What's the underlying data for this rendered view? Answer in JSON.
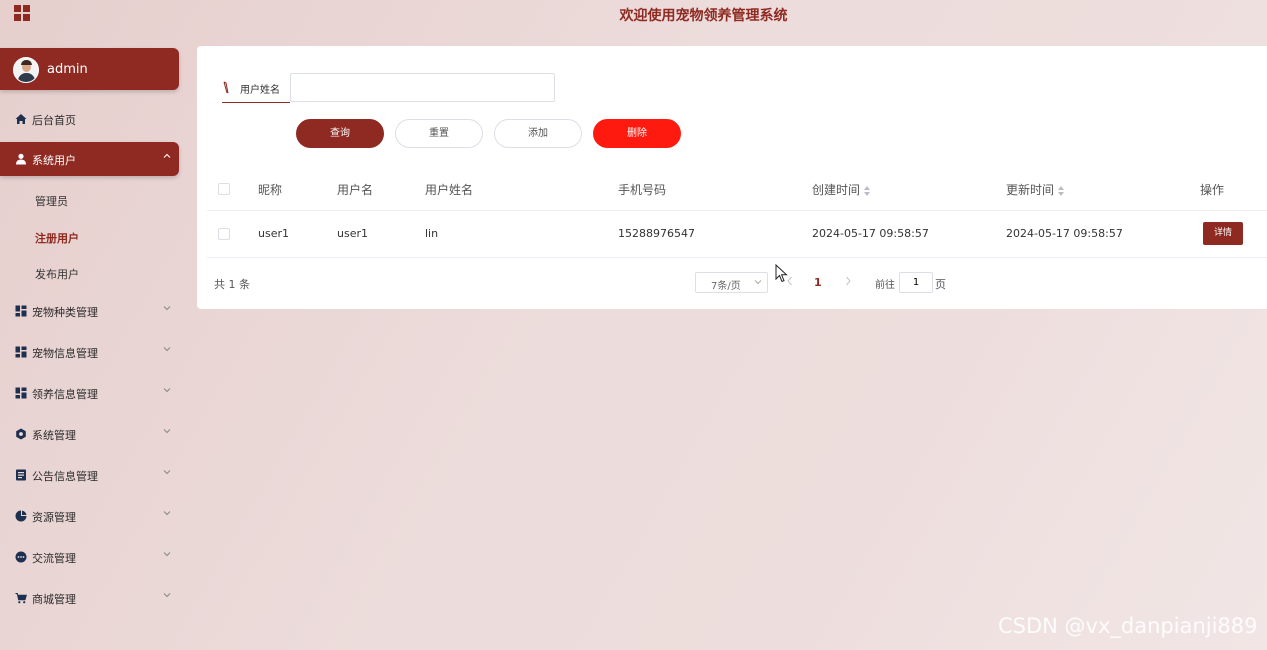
{
  "header": {
    "title": "欢迎使用宠物领养管理系统",
    "menu_icon": "grid-icon"
  },
  "user": {
    "name": "admin",
    "avatar": "avatar"
  },
  "sidebar": {
    "items": [
      {
        "label": "后台首页",
        "icon": "home-icon"
      },
      {
        "label": "系统用户",
        "icon": "user-icon",
        "expanded": true,
        "children": [
          {
            "label": "管理员"
          },
          {
            "label": "注册用户",
            "current": true
          },
          {
            "label": "发布用户"
          }
        ]
      },
      {
        "label": "宠物种类管理",
        "icon": "dashboard-icon"
      },
      {
        "label": "宠物信息管理",
        "icon": "dashboard-icon"
      },
      {
        "label": "领养信息管理",
        "icon": "dashboard-icon"
      },
      {
        "label": "系统管理",
        "icon": "settings-icon"
      },
      {
        "label": "公告信息管理",
        "icon": "notice-icon"
      },
      {
        "label": "资源管理",
        "icon": "pie-chart-icon"
      },
      {
        "label": "交流管理",
        "icon": "chat-icon"
      },
      {
        "label": "商城管理",
        "icon": "cart-icon"
      }
    ]
  },
  "search": {
    "label": "用户姓名",
    "value": "",
    "placeholder": ""
  },
  "buttons": {
    "query": "查询",
    "reset": "重置",
    "add": "添加",
    "delete": "删除"
  },
  "table": {
    "columns": [
      "昵称",
      "用户名",
      "用户姓名",
      "手机号码",
      "创建时间",
      "更新时间",
      "操作"
    ],
    "rows": [
      {
        "nickname": "user1",
        "username": "user1",
        "realname": "lin",
        "phone": "15288976547",
        "created": "2024-05-17 09:58:57",
        "updated": "2024-05-17 09:58:57",
        "action": "详情"
      }
    ]
  },
  "pagination": {
    "total": "共 1 条",
    "page_size": "7条/页",
    "current": "1",
    "goto_prefix": "前往",
    "goto_value": "1",
    "goto_suffix": "页"
  },
  "watermark": "CSDN @vx_danpianji889",
  "colors": {
    "accent": "#8e2a22",
    "danger": "#ff1a10"
  }
}
